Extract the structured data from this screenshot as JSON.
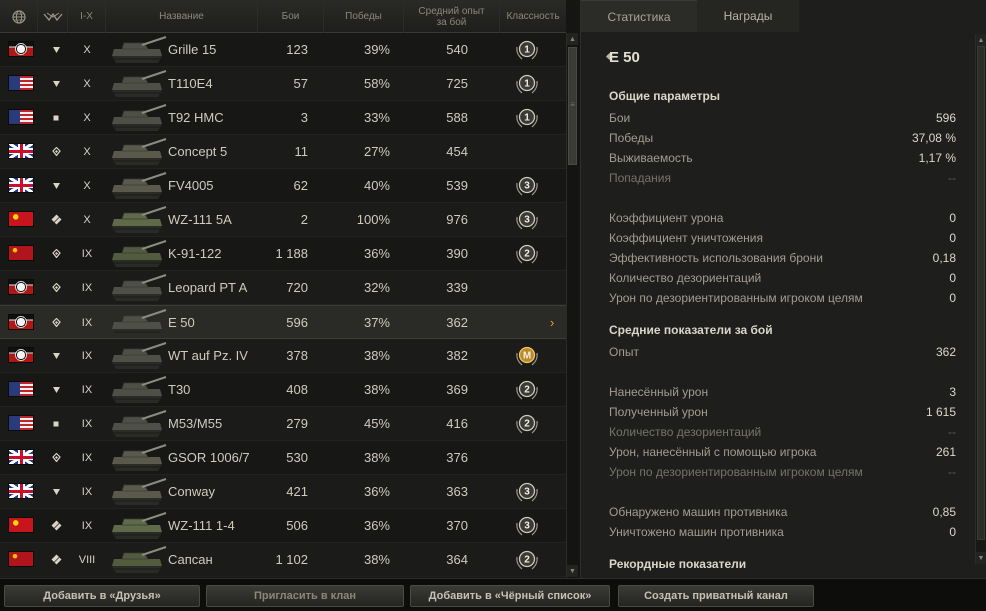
{
  "header": {
    "globe_icon": "globe-icon",
    "class_icon": "vehicle-class-icon",
    "tier_label": "I-X",
    "name_label": "Название",
    "battles_label": "Бои",
    "wins_label": "Победы",
    "avg_exp_label": "Средний опыт за бой",
    "mastery_label": "Классность"
  },
  "vehicles": [
    {
      "nation": "germany",
      "cls": "heavy",
      "tier": "X",
      "name": "Grille 15",
      "battles": "123",
      "winrate": "39%",
      "exp": "540",
      "mastery": "1"
    },
    {
      "nation": "usa",
      "cls": "heavy",
      "tier": "X",
      "name": "T110E4",
      "battles": "57",
      "winrate": "58%",
      "exp": "725",
      "mastery": "1"
    },
    {
      "nation": "usa",
      "cls": "spg",
      "tier": "X",
      "name": "T92 HMC",
      "battles": "3",
      "winrate": "33%",
      "exp": "588",
      "mastery": "1"
    },
    {
      "nation": "uk",
      "cls": "medium",
      "tier": "X",
      "name": "Concept 5",
      "battles": "11",
      "winrate": "27%",
      "exp": "454",
      "mastery": ""
    },
    {
      "nation": "uk",
      "cls": "heavy",
      "tier": "X",
      "name": "FV4005",
      "battles": "62",
      "winrate": "40%",
      "exp": "539",
      "mastery": "3"
    },
    {
      "nation": "china",
      "cls": "light",
      "tier": "X",
      "name": "WZ-111 5A",
      "battles": "2",
      "winrate": "100%",
      "exp": "976",
      "mastery": "3"
    },
    {
      "nation": "ussr",
      "cls": "medium",
      "tier": "IX",
      "name": "K-91-122",
      "battles": "1 188",
      "winrate": "36%",
      "exp": "390",
      "mastery": "2"
    },
    {
      "nation": "germany",
      "cls": "medium",
      "tier": "IX",
      "name": "Leopard PT A",
      "battles": "720",
      "winrate": "32%",
      "exp": "339",
      "mastery": ""
    },
    {
      "nation": "germany",
      "cls": "medium",
      "tier": "IX",
      "name": "E 50",
      "battles": "596",
      "winrate": "37%",
      "exp": "362",
      "mastery": ""
    },
    {
      "nation": "germany",
      "cls": "heavy",
      "tier": "IX",
      "name": "WT auf Pz. IV",
      "battles": "378",
      "winrate": "38%",
      "exp": "382",
      "mastery": "M"
    },
    {
      "nation": "usa",
      "cls": "heavy",
      "tier": "IX",
      "name": "T30",
      "battles": "408",
      "winrate": "38%",
      "exp": "369",
      "mastery": "2"
    },
    {
      "nation": "usa",
      "cls": "spg",
      "tier": "IX",
      "name": "M53/M55",
      "battles": "279",
      "winrate": "45%",
      "exp": "416",
      "mastery": "2"
    },
    {
      "nation": "uk",
      "cls": "medium",
      "tier": "IX",
      "name": "GSOR 1006/7",
      "battles": "530",
      "winrate": "38%",
      "exp": "376",
      "mastery": ""
    },
    {
      "nation": "uk",
      "cls": "heavy",
      "tier": "IX",
      "name": "Conway",
      "battles": "421",
      "winrate": "36%",
      "exp": "363",
      "mastery": "3"
    },
    {
      "nation": "china",
      "cls": "light",
      "tier": "IX",
      "name": "WZ-111 1-4",
      "battles": "506",
      "winrate": "36%",
      "exp": "370",
      "mastery": "3"
    },
    {
      "nation": "ussr",
      "cls": "light",
      "tier": "VIII",
      "name": "Сапсан",
      "battles": "1 102",
      "winrate": "38%",
      "exp": "364",
      "mastery": "2"
    }
  ],
  "selected_row": 8,
  "selected_arrow": "›",
  "scroll": {
    "up": "▲",
    "down": "▼",
    "grip": "≡"
  },
  "tabs": [
    {
      "label": "Статистика",
      "active": true
    },
    {
      "label": "Награды",
      "active": false
    }
  ],
  "vehicle_title": "E 50",
  "sections": {
    "general": "Общие параметры",
    "average": "Средние показатели за бой",
    "records": "Рекордные показатели"
  },
  "stats_general": [
    {
      "label": "Бои",
      "value": "596",
      "dim": false
    },
    {
      "label": "Победы",
      "value": "37,08 %",
      "dim": false
    },
    {
      "label": "Выживаемость",
      "value": "1,17 %",
      "dim": false
    },
    {
      "label": "Попадания",
      "value": "--",
      "dim": true
    },
    {
      "label": "Коэффициент урона",
      "value": "0",
      "dim": false
    },
    {
      "label": "Коэффициент уничтожения",
      "value": "0",
      "dim": false
    },
    {
      "label": "Эффективность использования брони",
      "value": "0,18",
      "dim": false
    },
    {
      "label": "Количество дезориентаций",
      "value": "0",
      "dim": false
    },
    {
      "label": "Урон по дезориентированным игроком целям",
      "value": "0",
      "dim": false
    }
  ],
  "stats_average": [
    {
      "label": "Опыт",
      "value": "362",
      "dim": false
    },
    {
      "label": "Нанесённый урон",
      "value": "3",
      "dim": false
    },
    {
      "label": "Полученный урон",
      "value": "1 615",
      "dim": false
    },
    {
      "label": "Количество дезориентаций",
      "value": "--",
      "dim": true
    },
    {
      "label": "Урон, нанесённый с помощью игрока",
      "value": "261",
      "dim": false
    },
    {
      "label": "Урон по дезориентированным игроком целям",
      "value": "--",
      "dim": true
    },
    {
      "label": "Обнаружено машин противника",
      "value": "0,85",
      "dim": false
    },
    {
      "label": "Уничтожено машин противника",
      "value": "0",
      "dim": false
    }
  ],
  "buttons": [
    {
      "label": "Добавить в «Друзья»",
      "dim": false
    },
    {
      "label": "Пригласить в клан",
      "dim": true
    },
    {
      "label": "Добавить в «Чёрный список»",
      "dim": false
    },
    {
      "label": "Создать приватный канал",
      "dim": false
    }
  ],
  "colors": {
    "accent": "#f0a020",
    "text": "#cfcbbd",
    "background": "#1a1a18"
  }
}
